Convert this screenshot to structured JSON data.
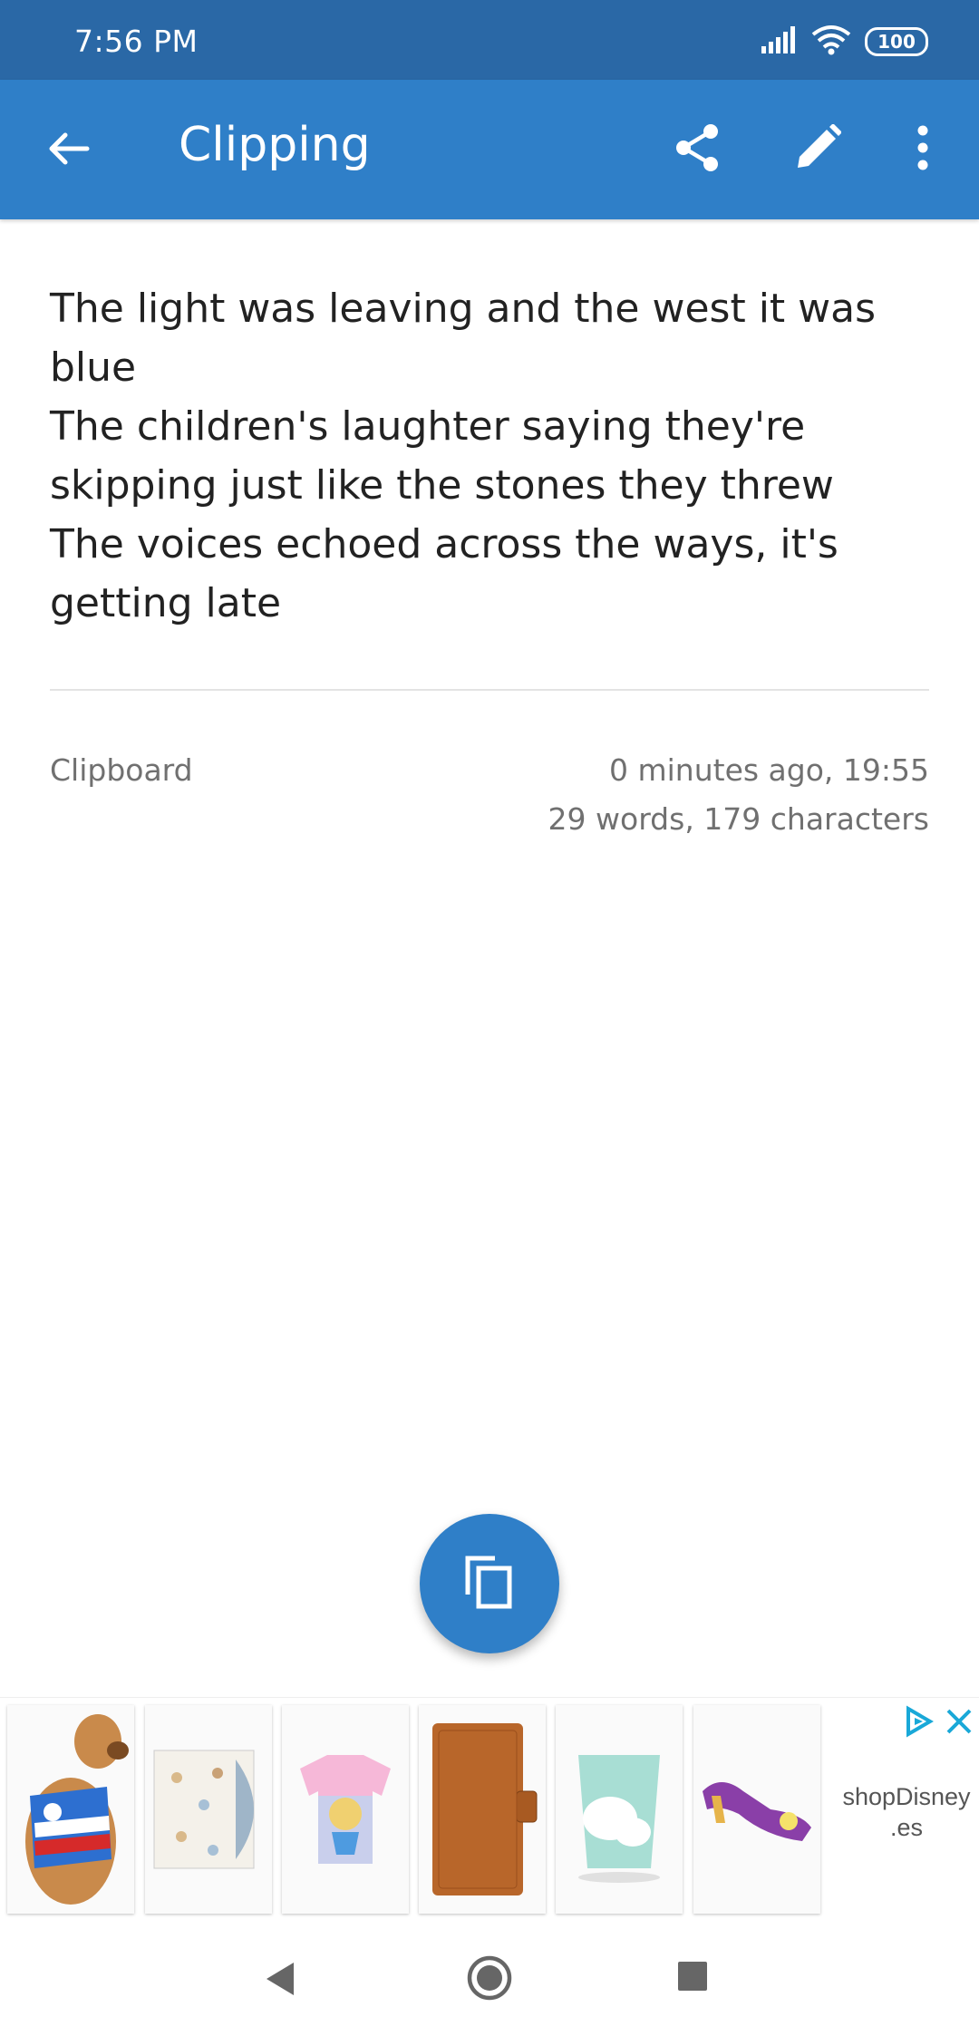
{
  "status_bar": {
    "time": "7:56 PM",
    "battery": "100",
    "icons": [
      "signal-icon",
      "wifi-icon",
      "battery-icon"
    ]
  },
  "app_bar": {
    "title": "Clipping",
    "icons": [
      "back-arrow-icon",
      "share-icon",
      "edit-pencil-icon",
      "more-vert-icon"
    ],
    "color": "#2F7FC8"
  },
  "clip": {
    "text": "The light was leaving and the west it was blue\nThe children's laughter saying they're skipping just like the stones they threw\nThe voices echoed across the ways, it's getting late",
    "source": "Clipboard",
    "time": "0 minutes ago, 19:55",
    "count": "29 words, 179 characters"
  },
  "fab": {
    "icon": "copy-icon"
  },
  "ad": {
    "advertiser": "shopDisney\n.es",
    "products": [
      "dog-costume",
      "photo-album",
      "alice-tshirt",
      "notebook",
      "paper-cup",
      "purple-shoe"
    ]
  },
  "nav_bar": {
    "icons": [
      "nav-back-icon",
      "nav-home-icon",
      "nav-recents-icon"
    ]
  }
}
